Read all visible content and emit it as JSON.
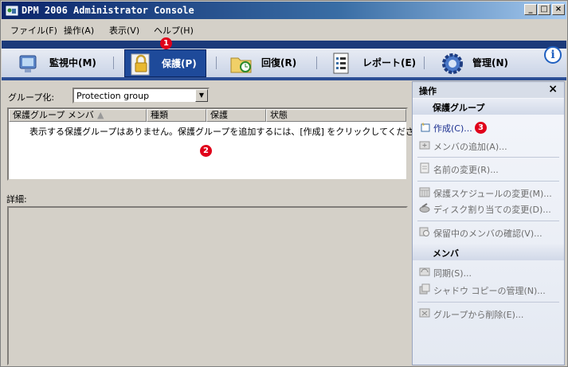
{
  "window": {
    "title": "DPM 2006 Administrator Console",
    "min": "_",
    "max": "□",
    "close": "×"
  },
  "menu": [
    "ファイル(F)",
    "操作(A)",
    "表示(V)",
    "ヘルプ(H)"
  ],
  "nav": {
    "tabs": [
      {
        "label": "監視中(M)",
        "icon": "monitor-icon"
      },
      {
        "label": "保護(P)",
        "icon": "lock-icon",
        "active": true
      },
      {
        "label": "回復(R)",
        "icon": "folder-recovery-icon"
      },
      {
        "label": "レポート(E)",
        "icon": "report-icon"
      },
      {
        "label": "管理(N)",
        "icon": "gear-icon"
      }
    ],
    "info": "i"
  },
  "badges": [
    "1",
    "2",
    "3"
  ],
  "left": {
    "group_label": "グループ化:",
    "group_value": "Protection group",
    "columns": [
      "保護グループ メンバ",
      "種類",
      "保護",
      "状態"
    ],
    "empty_message": "表示する保護グループはありません。保護グループを追加するには、[作成] をクリックしてください。",
    "details_label": "詳細:"
  },
  "actions": {
    "header": "操作",
    "close": "×",
    "section1": "保護グループ",
    "items1": [
      "作成(C)...",
      "メンバの追加(A)...",
      "名前の変更(R)...",
      "保護スケジュールの変更(M)...",
      "ディスク割り当ての変更(D)...",
      "保留中のメンバの確認(V)..."
    ],
    "section2": "メンバ",
    "items2": [
      "同期(S)...",
      "シャドウ コピーの管理(N)...",
      "グループから削除(E)..."
    ]
  },
  "colors": {
    "accent": "#1e4a9a",
    "badge": "#e0001a",
    "link": "#1a2e8f"
  }
}
